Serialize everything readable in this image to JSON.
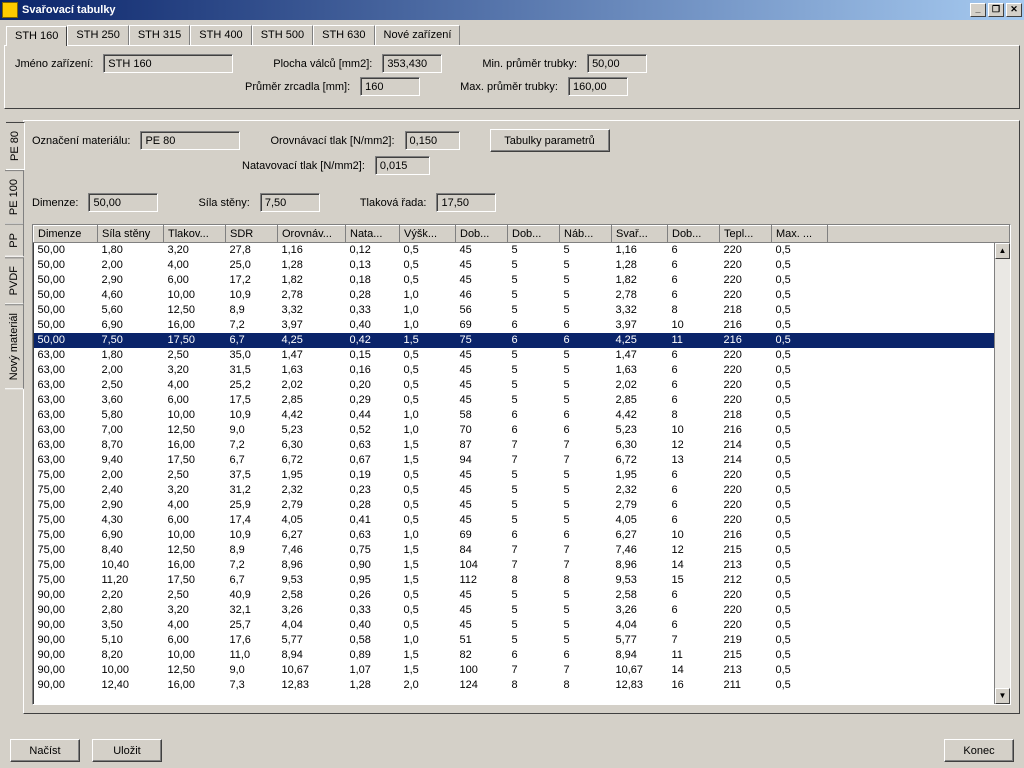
{
  "window": {
    "title": "Svařovací tabulky"
  },
  "top_tabs": [
    "STH 160",
    "STH 250",
    "STH 315",
    "STH 400",
    "STH 500",
    "STH 630",
    "Nové zařízení"
  ],
  "active_top_tab": 0,
  "device": {
    "name_label": "Jméno zařízení:",
    "name_value": "STH 160",
    "plocha_label": "Plocha válců [mm2]:",
    "plocha_value": "353,430",
    "prumer_zrcadla_label": "Průměr zrcadla [mm]:",
    "prumer_zrcadla_value": "160",
    "min_prumer_label": "Min. průměr trubky:",
    "min_prumer_value": "50,00",
    "max_prumer_label": "Max. průměr trubky:",
    "max_prumer_value": "160,00"
  },
  "vert_tabs": [
    "PE 80",
    "PE 100",
    "PP",
    "PVDF",
    "Nový materiál"
  ],
  "active_vert_tab": 0,
  "material": {
    "oznaceni_label": "Označení materiálu:",
    "oznaceni_value": "PE 80",
    "orov_tlak_label": "Orovnávací tlak [N/mm2]:",
    "orov_tlak_value": "0,150",
    "natav_tlak_label": "Natavovací tlak [N/mm2]:",
    "natav_tlak_value": "0,015",
    "btn_tabulky": "Tabulky parametrů",
    "dim_label": "Dimenze:",
    "dim_value": "50,00",
    "sila_label": "Síla stěny:",
    "sila_value": "7,50",
    "rada_label": "Tlaková řada:",
    "rada_value": "17,50"
  },
  "columns": [
    "Dimenze",
    "Síla stěny",
    "Tlakov...",
    "SDR",
    "Orovnáv...",
    "Nata...",
    "Výšk...",
    "Dob...",
    "Dob...",
    "Náb...",
    "Svař...",
    "Dob...",
    "Tepl...",
    "Max. ..."
  ],
  "selected_row": 6,
  "rows": [
    [
      "50,00",
      "1,80",
      "3,20",
      "27,8",
      "1,16",
      "0,12",
      "0,5",
      "45",
      "5",
      "5",
      "1,16",
      "6",
      "220",
      "0,5"
    ],
    [
      "50,00",
      "2,00",
      "4,00",
      "25,0",
      "1,28",
      "0,13",
      "0,5",
      "45",
      "5",
      "5",
      "1,28",
      "6",
      "220",
      "0,5"
    ],
    [
      "50,00",
      "2,90",
      "6,00",
      "17,2",
      "1,82",
      "0,18",
      "0,5",
      "45",
      "5",
      "5",
      "1,82",
      "6",
      "220",
      "0,5"
    ],
    [
      "50,00",
      "4,60",
      "10,00",
      "10,9",
      "2,78",
      "0,28",
      "1,0",
      "46",
      "5",
      "5",
      "2,78",
      "6",
      "220",
      "0,5"
    ],
    [
      "50,00",
      "5,60",
      "12,50",
      "8,9",
      "3,32",
      "0,33",
      "1,0",
      "56",
      "5",
      "5",
      "3,32",
      "8",
      "218",
      "0,5"
    ],
    [
      "50,00",
      "6,90",
      "16,00",
      "7,2",
      "3,97",
      "0,40",
      "1,0",
      "69",
      "6",
      "6",
      "3,97",
      "10",
      "216",
      "0,5"
    ],
    [
      "50,00",
      "7,50",
      "17,50",
      "6,7",
      "4,25",
      "0,42",
      "1,5",
      "75",
      "6",
      "6",
      "4,25",
      "11",
      "216",
      "0,5"
    ],
    [
      "63,00",
      "1,80",
      "2,50",
      "35,0",
      "1,47",
      "0,15",
      "0,5",
      "45",
      "5",
      "5",
      "1,47",
      "6",
      "220",
      "0,5"
    ],
    [
      "63,00",
      "2,00",
      "3,20",
      "31,5",
      "1,63",
      "0,16",
      "0,5",
      "45",
      "5",
      "5",
      "1,63",
      "6",
      "220",
      "0,5"
    ],
    [
      "63,00",
      "2,50",
      "4,00",
      "25,2",
      "2,02",
      "0,20",
      "0,5",
      "45",
      "5",
      "5",
      "2,02",
      "6",
      "220",
      "0,5"
    ],
    [
      "63,00",
      "3,60",
      "6,00",
      "17,5",
      "2,85",
      "0,29",
      "0,5",
      "45",
      "5",
      "5",
      "2,85",
      "6",
      "220",
      "0,5"
    ],
    [
      "63,00",
      "5,80",
      "10,00",
      "10,9",
      "4,42",
      "0,44",
      "1,0",
      "58",
      "6",
      "6",
      "4,42",
      "8",
      "218",
      "0,5"
    ],
    [
      "63,00",
      "7,00",
      "12,50",
      "9,0",
      "5,23",
      "0,52",
      "1,0",
      "70",
      "6",
      "6",
      "5,23",
      "10",
      "216",
      "0,5"
    ],
    [
      "63,00",
      "8,70",
      "16,00",
      "7,2",
      "6,30",
      "0,63",
      "1,5",
      "87",
      "7",
      "7",
      "6,30",
      "12",
      "214",
      "0,5"
    ],
    [
      "63,00",
      "9,40",
      "17,50",
      "6,7",
      "6,72",
      "0,67",
      "1,5",
      "94",
      "7",
      "7",
      "6,72",
      "13",
      "214",
      "0,5"
    ],
    [
      "75,00",
      "2,00",
      "2,50",
      "37,5",
      "1,95",
      "0,19",
      "0,5",
      "45",
      "5",
      "5",
      "1,95",
      "6",
      "220",
      "0,5"
    ],
    [
      "75,00",
      "2,40",
      "3,20",
      "31,2",
      "2,32",
      "0,23",
      "0,5",
      "45",
      "5",
      "5",
      "2,32",
      "6",
      "220",
      "0,5"
    ],
    [
      "75,00",
      "2,90",
      "4,00",
      "25,9",
      "2,79",
      "0,28",
      "0,5",
      "45",
      "5",
      "5",
      "2,79",
      "6",
      "220",
      "0,5"
    ],
    [
      "75,00",
      "4,30",
      "6,00",
      "17,4",
      "4,05",
      "0,41",
      "0,5",
      "45",
      "5",
      "5",
      "4,05",
      "6",
      "220",
      "0,5"
    ],
    [
      "75,00",
      "6,90",
      "10,00",
      "10,9",
      "6,27",
      "0,63",
      "1,0",
      "69",
      "6",
      "6",
      "6,27",
      "10",
      "216",
      "0,5"
    ],
    [
      "75,00",
      "8,40",
      "12,50",
      "8,9",
      "7,46",
      "0,75",
      "1,5",
      "84",
      "7",
      "7",
      "7,46",
      "12",
      "215",
      "0,5"
    ],
    [
      "75,00",
      "10,40",
      "16,00",
      "7,2",
      "8,96",
      "0,90",
      "1,5",
      "104",
      "7",
      "7",
      "8,96",
      "14",
      "213",
      "0,5"
    ],
    [
      "75,00",
      "11,20",
      "17,50",
      "6,7",
      "9,53",
      "0,95",
      "1,5",
      "112",
      "8",
      "8",
      "9,53",
      "15",
      "212",
      "0,5"
    ],
    [
      "90,00",
      "2,20",
      "2,50",
      "40,9",
      "2,58",
      "0,26",
      "0,5",
      "45",
      "5",
      "5",
      "2,58",
      "6",
      "220",
      "0,5"
    ],
    [
      "90,00",
      "2,80",
      "3,20",
      "32,1",
      "3,26",
      "0,33",
      "0,5",
      "45",
      "5",
      "5",
      "3,26",
      "6",
      "220",
      "0,5"
    ],
    [
      "90,00",
      "3,50",
      "4,00",
      "25,7",
      "4,04",
      "0,40",
      "0,5",
      "45",
      "5",
      "5",
      "4,04",
      "6",
      "220",
      "0,5"
    ],
    [
      "90,00",
      "5,10",
      "6,00",
      "17,6",
      "5,77",
      "0,58",
      "1,0",
      "51",
      "5",
      "5",
      "5,77",
      "7",
      "219",
      "0,5"
    ],
    [
      "90,00",
      "8,20",
      "10,00",
      "11,0",
      "8,94",
      "0,89",
      "1,5",
      "82",
      "6",
      "6",
      "8,94",
      "11",
      "215",
      "0,5"
    ],
    [
      "90,00",
      "10,00",
      "12,50",
      "9,0",
      "10,67",
      "1,07",
      "1,5",
      "100",
      "7",
      "7",
      "10,67",
      "14",
      "213",
      "0,5"
    ],
    [
      "90,00",
      "12,40",
      "16,00",
      "7,3",
      "12,83",
      "1,28",
      "2,0",
      "124",
      "8",
      "8",
      "12,83",
      "16",
      "211",
      "0,5"
    ]
  ],
  "footer": {
    "load": "Načíst",
    "save": "Uložit",
    "exit": "Konec"
  }
}
